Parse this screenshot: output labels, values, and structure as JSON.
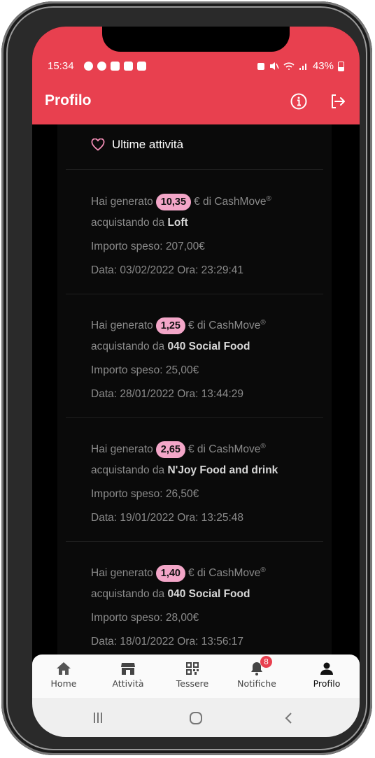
{
  "status": {
    "time": "15:34",
    "battery": "43%"
  },
  "header": {
    "title": "Profilo"
  },
  "section": {
    "title": "Ultime attività"
  },
  "entries": [
    {
      "prefix": "Hai generato",
      "amount": "10,35",
      "suffix": "€ di CashMove",
      "reg": "®",
      "buy_prefix": "acquistando da",
      "store": "Loft",
      "spent": "Importo speso: 207,00€",
      "date": "Data: 03/02/2022 Ora: 23:29:41"
    },
    {
      "prefix": "Hai generato",
      "amount": "1,25",
      "suffix": "€ di CashMove",
      "reg": "®",
      "buy_prefix": "acquistando da",
      "store": "040 Social Food",
      "spent": "Importo speso: 25,00€",
      "date": "Data: 28/01/2022 Ora: 13:44:29"
    },
    {
      "prefix": "Hai generato",
      "amount": "2,65",
      "suffix": "€ di CashMove",
      "reg": "®",
      "buy_prefix": "acquistando da",
      "store": "N'Joy Food and drink",
      "spent": "Importo speso: 26,50€",
      "date": "Data: 19/01/2022 Ora: 13:25:48"
    },
    {
      "prefix": "Hai generato",
      "amount": "1,40",
      "suffix": "€ di CashMove",
      "reg": "®",
      "buy_prefix": "acquistando da",
      "store": "040 Social Food",
      "spent": "Importo speso: 28,00€",
      "date": "Data: 18/01/2022 Ora: 13:56:17"
    }
  ],
  "tabs": [
    {
      "label": "Home",
      "icon": "home-icon"
    },
    {
      "label": "Attività",
      "icon": "store-icon"
    },
    {
      "label": "Tessere",
      "icon": "qr-icon"
    },
    {
      "label": "Notifiche",
      "icon": "bell-icon",
      "badge": "8"
    },
    {
      "label": "Profilo",
      "icon": "user-icon"
    }
  ],
  "colors": {
    "accent": "#e8404f",
    "badge": "#f3a6c8",
    "background": "#000000"
  }
}
